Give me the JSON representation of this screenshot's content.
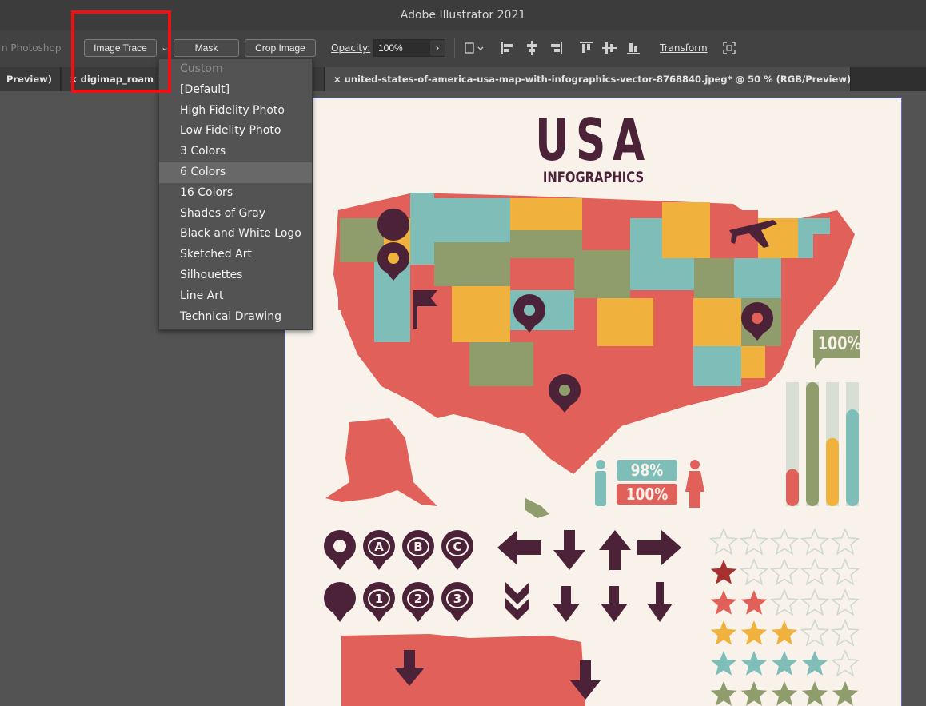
{
  "window": {
    "title": "Adobe Illustrator 2021"
  },
  "control_bar": {
    "photoshop_label": "n Photoshop",
    "image_trace_label": "Image Trace",
    "dropdown_arrow": "⌄",
    "mask_label": "Mask",
    "crop_image_label": "Crop Image",
    "opacity_label": "Opacity:",
    "opacity_value": "100%",
    "opacity_arrow": "›",
    "transform_label": "Transform"
  },
  "tabs": [
    {
      "label": "Preview)"
    },
    {
      "label": "×  digimap_roam ("
    },
    {
      "label": ")"
    },
    {
      "label": "×  united-states-of-america-usa-map-with-infographics-vector-8768840.jpeg* @ 50 % (RGB/Preview)"
    }
  ],
  "dropdown": {
    "items": [
      {
        "label": "Custom",
        "disabled": true
      },
      {
        "label": "[Default]"
      },
      {
        "label": "High Fidelity Photo"
      },
      {
        "label": "Low Fidelity Photo"
      },
      {
        "label": "3 Colors"
      },
      {
        "label": "6 Colors",
        "highlighted": true
      },
      {
        "label": "16 Colors"
      },
      {
        "label": "Shades of Gray"
      },
      {
        "label": "Black and White Logo"
      },
      {
        "label": "Sketched Art"
      },
      {
        "label": "Silhouettes"
      },
      {
        "label": "Line Art"
      },
      {
        "label": "Technical Drawing"
      }
    ]
  },
  "artwork": {
    "title": "USA",
    "subtitle": "INFOGRAPHICS",
    "badge_100": "100%",
    "stat_male": "98%",
    "stat_female": "100%",
    "pin_letters": [
      "A",
      "B",
      "C"
    ],
    "pin_numbers": [
      "1",
      "2",
      "3"
    ],
    "colors": {
      "dark": "#4b2237",
      "red": "#e2605a",
      "yellow": "#f0b23c",
      "teal": "#7fbdb8",
      "olive": "#8f9d6c",
      "cream": "#f8f2ea"
    },
    "bars": [
      0.3,
      1.0,
      0.55,
      0.78
    ],
    "star_ratings": [
      0,
      1,
      2,
      3,
      4,
      5
    ]
  }
}
